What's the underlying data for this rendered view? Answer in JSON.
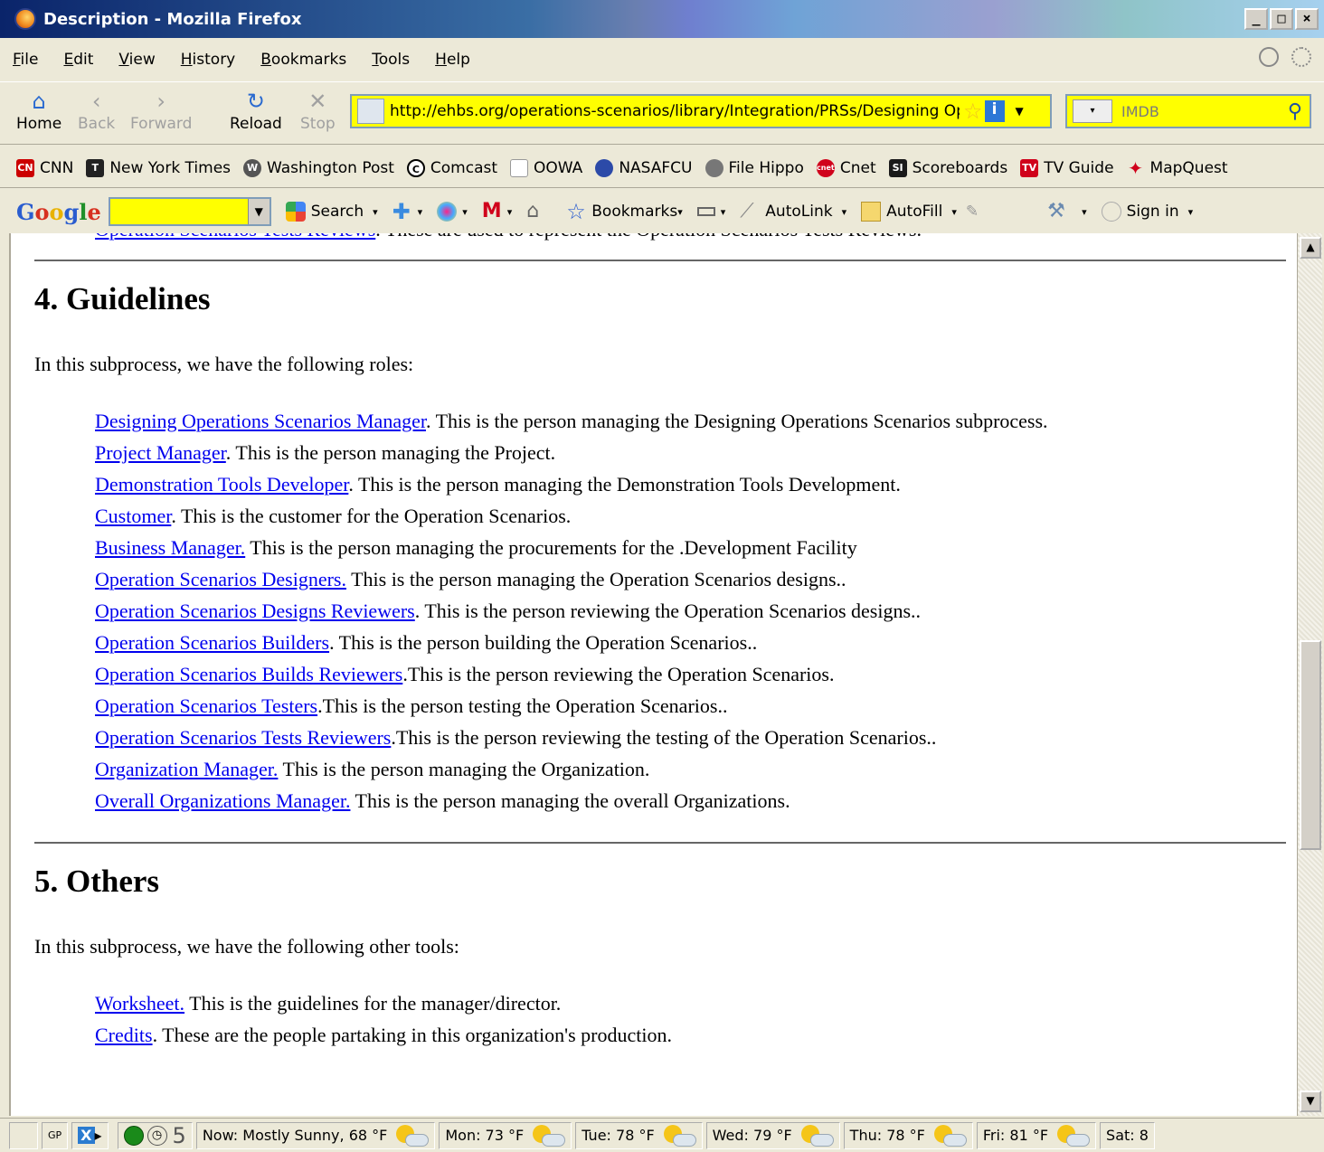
{
  "window": {
    "title": "Description - Mozilla Firefox"
  },
  "menu": [
    "File",
    "Edit",
    "View",
    "History",
    "Bookmarks",
    "Tools",
    "Help"
  ],
  "nav": {
    "home": "Home",
    "back": "Back",
    "forward": "Forward",
    "reload": "Reload",
    "stop": "Stop",
    "url": "http://ehbs.org/operations-scenarios/library/Integration/PRSs/Designing Ope",
    "search_placeholder": "IMDB"
  },
  "bookmarks": [
    "CNN",
    "New York Times",
    "Washington Post",
    "Comcast",
    "OOWA",
    "NASAFCU",
    "File Hippo",
    "Cnet",
    "Scoreboards",
    "TV Guide",
    "MapQuest"
  ],
  "google_toolbar": {
    "search": "Search",
    "bookmarks": "Bookmarks",
    "autolink": "AutoLink",
    "autofill": "AutoFill",
    "signin": "Sign in"
  },
  "content": {
    "top_line": {
      "link": "Operation Scenarios Tests Reviews",
      "text": ". These are used to represent the Operation Scenarios Tests Reviews."
    },
    "guidelines": {
      "heading": "4. Guidelines",
      "intro": "In this subprocess, we have the following roles:",
      "roles": [
        {
          "link": "Designing Operations Scenarios Manager",
          "text": ". This is the person managing the Designing Operations Scenarios subprocess."
        },
        {
          "link": "Project Manager",
          "text": ". This is the person managing the Project."
        },
        {
          "link": "Demonstration Tools Developer",
          "text": ". This is the person managing the Demonstration Tools Development."
        },
        {
          "link": "Customer",
          "text": ". This is the customer for the Operation Scenarios."
        },
        {
          "link": "Business Manager.",
          "text": " This is the person managing the procurements for the .Development Facility"
        },
        {
          "link": "Operation Scenarios Designers.",
          "text": " This is the person managing the Operation Scenarios designs.."
        },
        {
          "link": "Operation Scenarios Designs Reviewers",
          "text": ". This is the person reviewing the Operation Scenarios designs.."
        },
        {
          "link": "Operation Scenarios Builders",
          "text": ". This is the person building the Operation Scenarios.."
        },
        {
          "link": "Operation Scenarios Builds Reviewers",
          "text": ".This is the person reviewing the Operation Scenarios."
        },
        {
          "link": "Operation Scenarios Testers",
          "text": ".This is the person testing the Operation Scenarios.."
        },
        {
          "link": "Operation Scenarios Tests Reviewers",
          "text": ".This is the person reviewing the testing of the Operation Scenarios.."
        },
        {
          "link": "Organization Manager.",
          "text": " This is the person managing the Organization."
        },
        {
          "link": "Overall Organizations Manager.",
          "text": " This is the person managing the overall Organizations."
        }
      ]
    },
    "others": {
      "heading": "5. Others",
      "intro": "In this subprocess, we have the following other tools:",
      "items": [
        {
          "link": "Worksheet.",
          "text": " This is the guidelines for the manager/director."
        },
        {
          "link": "Credits",
          "text": ". These are the people partaking in this organization's production."
        }
      ]
    }
  },
  "status": {
    "gp": "GP",
    "count": "5",
    "weather": [
      "Now: Mostly Sunny, 68 °F",
      "Mon: 73 °F",
      "Tue: 78 °F",
      "Wed: 79 °F",
      "Thu: 78 °F",
      "Fri: 81 °F",
      "Sat: 8"
    ]
  }
}
